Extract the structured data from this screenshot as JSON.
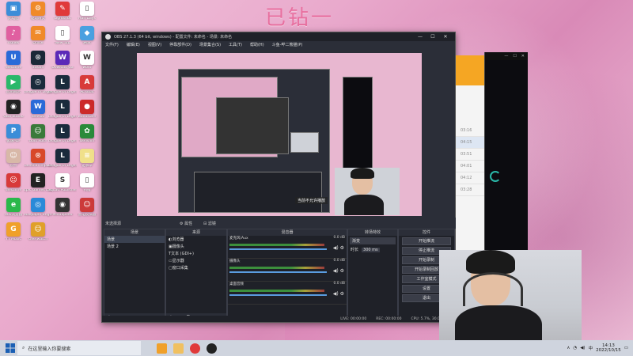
{
  "wallpaper": {
    "title": "已钻一"
  },
  "desktop_icons": [
    {
      "label": "此电脑",
      "color": "#3b8dd8",
      "glyph": "▣"
    },
    {
      "label": "驱动精灵",
      "color": "#f08a2a",
      "glyph": "⚙"
    },
    {
      "label": "Lightshot",
      "color": "#e03a3a",
      "glyph": "✎"
    },
    {
      "label": "Half Days",
      "color": "#ffffff",
      "glyph": "▯"
    },
    {
      "label": "iTunes",
      "color": "#e05fa0",
      "glyph": "♪"
    },
    {
      "label": "Office",
      "color": "#f08a2a",
      "glyph": "✉"
    },
    {
      "label": "New Tab",
      "color": "#ffffff",
      "glyph": "▯"
    },
    {
      "label": "腾讯",
      "color": "#4aa0e0",
      "glyph": "◆"
    },
    {
      "label": "WeGame",
      "color": "#2a6ad8",
      "glyph": "U"
    },
    {
      "label": "Steam",
      "color": "#1b2838",
      "glyph": "⊙"
    },
    {
      "label": "Dowload Ga",
      "color": "#5b2ab8",
      "glyph": "W"
    },
    {
      "label": "word",
      "color": "#ffffff",
      "glyph": "W"
    },
    {
      "label": "应用商店",
      "color": "#2ab86a",
      "glyph": "▶"
    },
    {
      "label": "League of Legends",
      "color": "#1a2b3c",
      "glyph": "◎"
    },
    {
      "label": "League of Legends",
      "color": "#1a2b3c",
      "glyph": "L"
    },
    {
      "label": "Acrobat",
      "color": "#d83a3a",
      "glyph": "A"
    },
    {
      "label": "OBS Studio",
      "color": "#222222",
      "glyph": "◉"
    },
    {
      "label": "WeMod",
      "color": "#2a6ad8",
      "glyph": "W"
    },
    {
      "label": "League of Legends",
      "color": "#1a2b3c",
      "glyph": "L"
    },
    {
      "label": "Bandicam",
      "color": "#cc2a2a",
      "glyph": "●"
    },
    {
      "label": "极速PDF",
      "color": "#3b8dd8",
      "glyph": "P"
    },
    {
      "label": "Gold Rush",
      "color": "#3a7a3a",
      "glyph": "☺"
    },
    {
      "label": "League of Legends",
      "color": "#1a2b3c",
      "glyph": "L"
    },
    {
      "label": "Genshin",
      "color": "#2a8a3a",
      "glyph": "✿"
    },
    {
      "label": "原神",
      "color": "#d8b8a8",
      "glyph": "☺"
    },
    {
      "label": "Genshin Impact",
      "color": "#d8482a",
      "glyph": "⊙"
    },
    {
      "label": "League of Legends",
      "color": "#1a2b3c",
      "glyph": "L"
    },
    {
      "label": "记事本",
      "color": "#f0e08a",
      "glyph": "≡"
    },
    {
      "label": "WeGame",
      "color": "#d83a3a",
      "glyph": "☺"
    },
    {
      "label": "Epic Games Launcher",
      "color": "#222222",
      "glyph": "E"
    },
    {
      "label": "Squad Publisher",
      "color": "#ffffff",
      "glyph": "S"
    },
    {
      "label": "扫描",
      "color": "#ffffff",
      "glyph": "▯"
    },
    {
      "label": "360浏览器",
      "color": "#2ab84a",
      "glyph": "e"
    },
    {
      "label": "Wallpaper Engine",
      "color": "#2a8ad8",
      "glyph": "◎"
    },
    {
      "label": "MindSpeed",
      "color": "#333333",
      "glyph": "◉"
    },
    {
      "label": "雷电模拟器",
      "color": "#cc3a3a",
      "glyph": "☺"
    },
    {
      "label": "YY Music",
      "color": "#f0a02a",
      "glyph": "G"
    },
    {
      "label": "Overwatch",
      "color": "#e0a02a",
      "glyph": "☺"
    }
  ],
  "obs": {
    "title": "OBS 27.1.3 (64 bit, windows) - 配置文件: 未命名 - 场景: 未命名",
    "menu": [
      "文件(F)",
      "编辑(E)",
      "视图(V)",
      "停靠部件(D)",
      "场景集合(S)",
      "工具(T)",
      "帮助(H)",
      "斗鱼-哔二熊猫(P)"
    ],
    "preview_toast": "当前不允许播放",
    "scene_header": "未选择源",
    "scene_btn_props": "⚙ 属性",
    "scene_btn_filters": "⊟ 滤镜",
    "docks": {
      "scenes": {
        "title": "场景",
        "items": [
          "场景",
          "场景 2"
        ]
      },
      "sources": {
        "title": "来源",
        "items": [
          "浏览器",
          "摄像头",
          "文本 (GDI+)",
          "显示器",
          "窗口采集"
        ]
      },
      "mixer": {
        "title": "混音器",
        "channels": [
          {
            "name": "麦克风/Aux",
            "value": "0.0 dB",
            "level": 0.82
          },
          {
            "name": "摄像头",
            "value": "0.0 dB",
            "level": 0.82
          },
          {
            "name": "桌面音频",
            "value": "0.0 dB",
            "level": 0.82
          }
        ]
      },
      "transitions": {
        "title": "转场特效",
        "type_label": "渐变",
        "duration_label": "时长",
        "duration": "300 ms"
      },
      "controls": {
        "title": "控件",
        "buttons": [
          "开始推流",
          "停止推流",
          "开始录制",
          "开始录制回放",
          "工作室模式",
          "设置",
          "退出"
        ]
      }
    },
    "status": {
      "live": "LIVE: 00:00:00",
      "rec": "REC: 00:00:00",
      "cpu": "CPU: 5.7%, 30.00 fps"
    }
  },
  "music_window": {
    "times": [
      "03:16",
      "04:15",
      "03:51",
      "04:01",
      "04:12",
      "03:28"
    ]
  },
  "taskbar": {
    "search_placeholder": "在这里输入你要搜索",
    "time": "14:13",
    "date": "2022/10/15",
    "tray_lang": "中"
  }
}
